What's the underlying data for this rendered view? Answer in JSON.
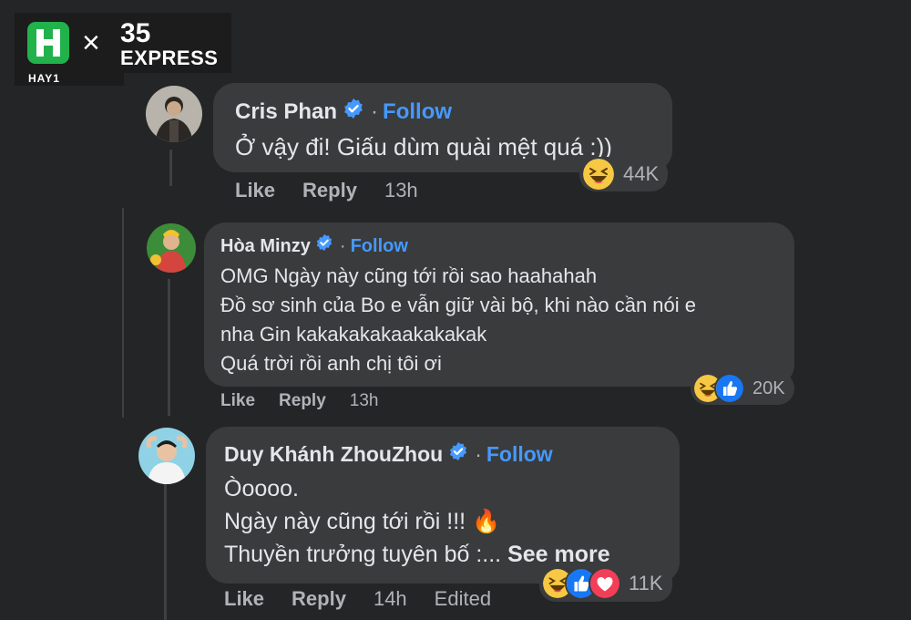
{
  "logo": {
    "letter": "H",
    "brand": "HAY1",
    "cross": "×",
    "partner_number": "35",
    "partner_name": "EXPRESS",
    "brand_color": "#22b24c"
  },
  "theme": {
    "background": "#242526",
    "bubble": "#3a3b3c",
    "follow_color": "#4599ff",
    "muted": "#b0b3b8"
  },
  "comments": [
    {
      "name": "Cris Phan",
      "verified_icon": "verified-badge-icon",
      "separator": "·",
      "follow": "Follow",
      "lines": [
        "Ở vậy đi! Giấu dùm quài mệt quá :))"
      ],
      "actions": {
        "like": "Like",
        "reply": "Reply",
        "time": "13h"
      },
      "reactions": {
        "icons": [
          "haha-icon"
        ],
        "count": "44K"
      }
    },
    {
      "name": "Hòa Minzy",
      "verified_icon": "verified-badge-icon",
      "separator": "·",
      "follow": "Follow",
      "lines": [
        "OMG Ngày này cũng tới rồi sao haahahah",
        "Đồ sơ sinh của Bo e vẫn giữ vài bộ, khi nào cần nói e",
        "nha Gin kakakakakaakakakak",
        "Quá trời rồi anh chị tôi ơi"
      ],
      "actions": {
        "like": "Like",
        "reply": "Reply",
        "time": "13h"
      },
      "reactions": {
        "icons": [
          "haha-icon",
          "like-icon"
        ],
        "count": "20K"
      }
    },
    {
      "name": "Duy Khánh ZhouZhou",
      "verified_icon": "verified-badge-icon",
      "separator": "·",
      "follow": "Follow",
      "lines": [
        "Òoooo.",
        "Ngày này cũng tới rồi !!! 🔥",
        "Thuyền trưởng tuyên bố :..."
      ],
      "see_more": "See more",
      "actions": {
        "like": "Like",
        "reply": "Reply",
        "time": "14h",
        "edited": "Edited"
      },
      "reactions": {
        "icons": [
          "haha-icon",
          "like-icon",
          "love-icon"
        ],
        "count": "11K"
      }
    }
  ]
}
